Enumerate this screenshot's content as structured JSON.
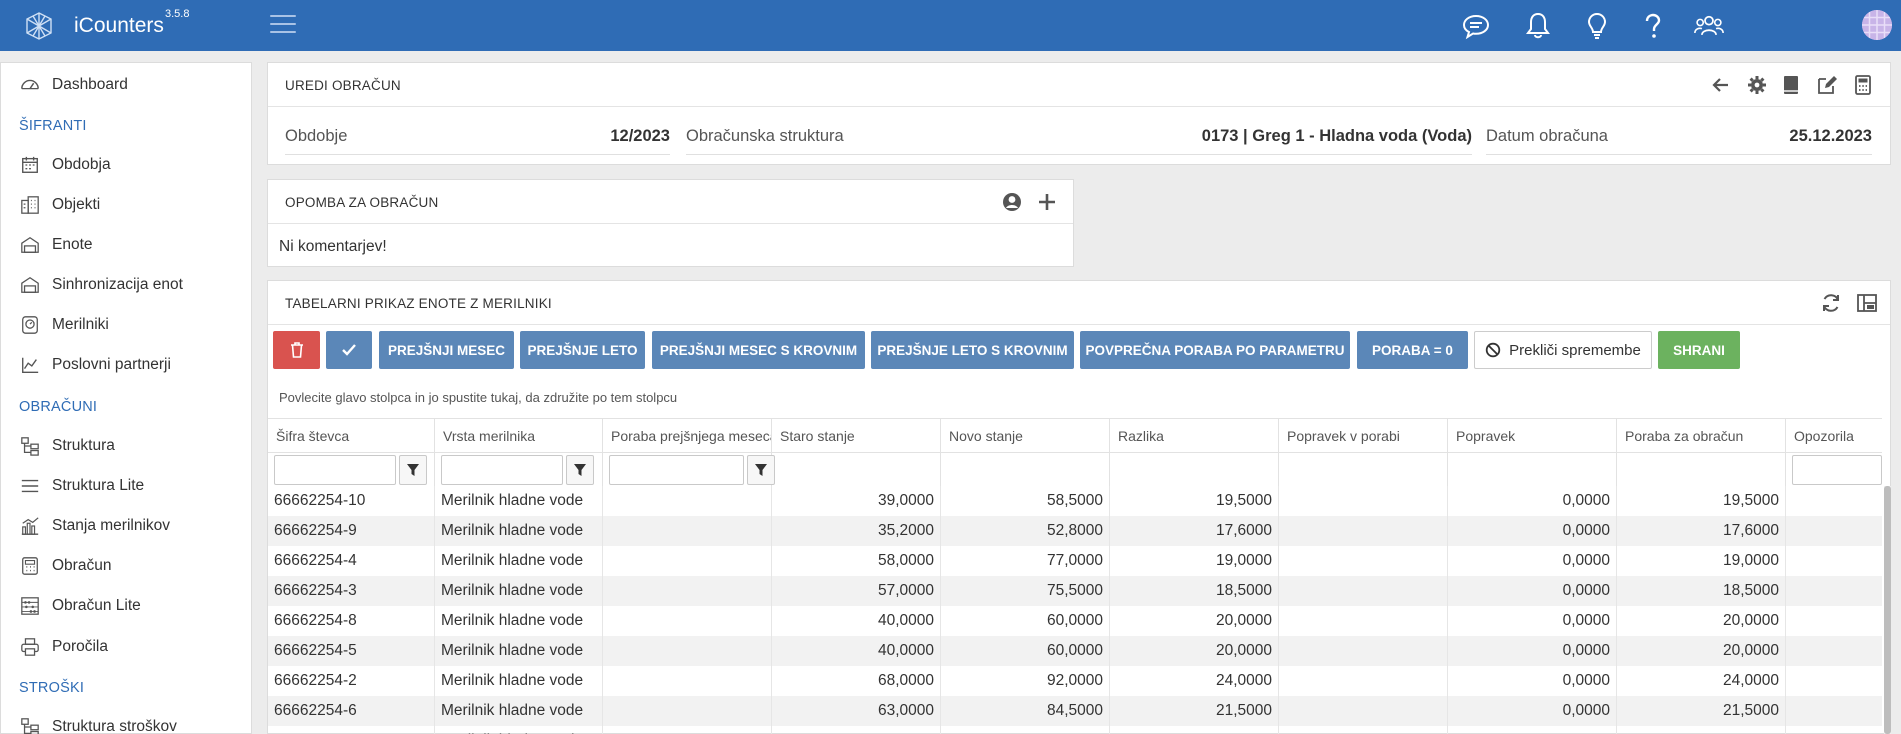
{
  "app": {
    "name": "iCounters",
    "version": "3.5.8"
  },
  "topbar": {
    "icons": [
      "chat-icon",
      "bell-icon",
      "lightbulb-icon",
      "help-icon",
      "users-icon"
    ]
  },
  "sidebar": {
    "items": [
      {
        "label": "Dashboard",
        "icon": "dashboard-icon"
      },
      {
        "section": "ŠIFRANTI"
      },
      {
        "label": "Obdobja",
        "icon": "calendar-icon"
      },
      {
        "label": "Objekti",
        "icon": "buildings-icon"
      },
      {
        "label": "Enote",
        "icon": "unit-icon"
      },
      {
        "label": "Sinhronizacija enot",
        "icon": "sync-unit-icon"
      },
      {
        "label": "Merilniki",
        "icon": "meter-icon"
      },
      {
        "label": "Poslovni partnerji",
        "icon": "chart-line-icon"
      },
      {
        "section": "OBRAČUNI"
      },
      {
        "label": "Struktura",
        "icon": "structure-icon"
      },
      {
        "label": "Struktura Lite",
        "icon": "list-icon"
      },
      {
        "label": "Stanja merilnikov",
        "icon": "chart-bars-icon"
      },
      {
        "label": "Obračun",
        "icon": "calculator-icon"
      },
      {
        "label": "Obračun Lite",
        "icon": "abacus-icon"
      },
      {
        "label": "Poročila",
        "icon": "print-icon"
      },
      {
        "section": "STROŠKI"
      },
      {
        "label": "Struktura stroškov",
        "icon": "structure-icon"
      }
    ]
  },
  "edit_panel": {
    "title": "UREDI OBRAČUN",
    "fields": [
      {
        "label": "Obdobje",
        "value": "12/2023"
      },
      {
        "label": "Obračunska struktura",
        "value": "0173 | Greg 1 - Hladna voda (Voda)"
      },
      {
        "label": "Datum obračuna",
        "value": "25.12.2023"
      }
    ]
  },
  "note_panel": {
    "title": "OPOMBA ZA OBRAČUN",
    "text": "Ni komentarjev!"
  },
  "table_panel": {
    "title": "TABELARNI PRIKAZ ENOTE Z MERILNIKI",
    "buttons": {
      "prev_month": "PREJŠNJI MESEC",
      "prev_year": "PREJŠNJE LETO",
      "prev_month_roof": "PREJŠNJI MESEC S KROVNIM",
      "prev_year_roof": "PREJŠNJE LETO S KROVNIM",
      "avg": "POVPREČNA PORABA PO PARAMETRU",
      "zero": "PORABA = 0",
      "cancel": "Prekliči spremembe",
      "save": "SHRANI"
    },
    "group_hint": "Povlecite glavo stolpca in jo spustite tukaj, da združite po tem stolpcu",
    "columns": [
      "Šifra števca",
      "Vrsta merilnika",
      "Poraba prejšnjega meseca",
      "Staro stanje",
      "Novo stanje",
      "Razlika",
      "Popravek v porabi",
      "Popravek",
      "Poraba za obračun",
      "Opozorila"
    ],
    "rows": [
      [
        "66662254-10",
        "Merilnik hladne vode",
        "",
        "39,0000",
        "58,5000",
        "19,5000",
        "",
        "0,0000",
        "19,5000",
        ""
      ],
      [
        "66662254-9",
        "Merilnik hladne vode",
        "",
        "35,2000",
        "52,8000",
        "17,6000",
        "",
        "0,0000",
        "17,6000",
        ""
      ],
      [
        "66662254-4",
        "Merilnik hladne vode",
        "",
        "58,0000",
        "77,0000",
        "19,0000",
        "",
        "0,0000",
        "19,0000",
        ""
      ],
      [
        "66662254-3",
        "Merilnik hladne vode",
        "",
        "57,0000",
        "75,5000",
        "18,5000",
        "",
        "0,0000",
        "18,5000",
        ""
      ],
      [
        "66662254-8",
        "Merilnik hladne vode",
        "",
        "40,0000",
        "60,0000",
        "20,0000",
        "",
        "0,0000",
        "20,0000",
        ""
      ],
      [
        "66662254-5",
        "Merilnik hladne vode",
        "",
        "40,0000",
        "60,0000",
        "20,0000",
        "",
        "0,0000",
        "20,0000",
        ""
      ],
      [
        "66662254-2",
        "Merilnik hladne vode",
        "",
        "68,0000",
        "92,0000",
        "24,0000",
        "",
        "0,0000",
        "24,0000",
        ""
      ],
      [
        "66662254-6",
        "Merilnik hladne vode",
        "",
        "63,0000",
        "84,5000",
        "21,5000",
        "",
        "0,0000",
        "21,5000",
        ""
      ],
      [
        "",
        "Merilnik hladne vode",
        "",
        "",
        "",
        "",
        "",
        "",
        "",
        ""
      ]
    ]
  },
  "colors": {
    "primary": "#2f6cb5",
    "button_blue": "#5b87b8",
    "danger": "#d9534f",
    "success": "#6cb25f"
  }
}
